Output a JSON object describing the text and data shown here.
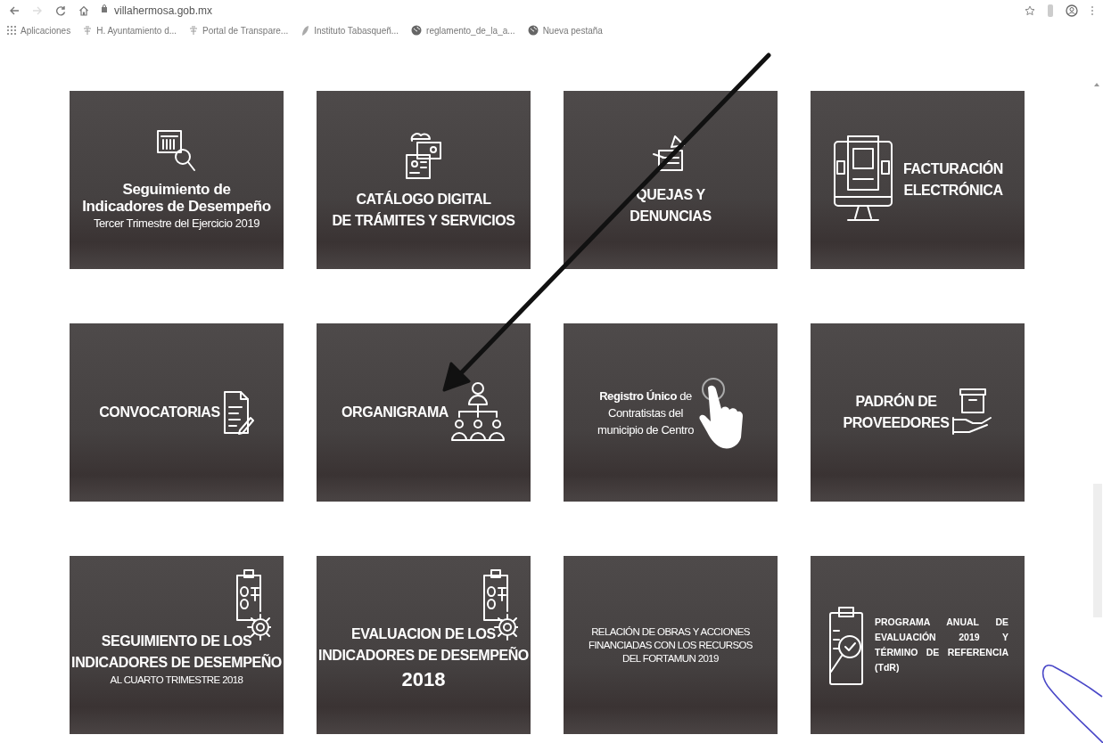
{
  "toolbar": {
    "forward_button": {
      "disabled": true
    },
    "url": "villahermosa.gob.mx"
  },
  "bookmarks": [
    {
      "label": "Aplicaciones",
      "kind": "apps"
    },
    {
      "label": "H. Ayuntamiento d...",
      "kind": "site"
    },
    {
      "label": "Portal de Transpare...",
      "kind": "site"
    },
    {
      "label": "Instituto Tabasqueñ...",
      "kind": "leaf"
    },
    {
      "label": "reglamento_de_la_a...",
      "kind": "globe"
    },
    {
      "label": "Nueva pestaña",
      "kind": "globe"
    }
  ],
  "tiles": [
    {
      "kind": "icon-top",
      "lines": [
        {
          "text": "Seguimiento de",
          "kind": "title"
        },
        {
          "text": "Indicadores de Desempeño",
          "kind": "title"
        },
        {
          "text": "Tercer Trimestre del Ejercicio 2019",
          "kind": "sub"
        }
      ]
    },
    {
      "kind": "icon-top",
      "lines": [
        {
          "text": "CATÁLOGO DIGITAL",
          "kind": "caps"
        },
        {
          "text": "DE TRÁMITES Y SERVICIOS",
          "kind": "caps"
        }
      ]
    },
    {
      "kind": "icon-top",
      "lines": [
        {
          "text": "QUEJAS Y",
          "kind": "caps"
        },
        {
          "text": "DENUNCIAS",
          "kind": "caps"
        }
      ]
    },
    {
      "kind": "icon-left",
      "lines": [
        {
          "text": "FACTURACIÓN",
          "kind": "caps"
        },
        {
          "text": "ELECTRÓNICA",
          "kind": "caps"
        }
      ]
    },
    {
      "kind": "icon-right",
      "lines": [
        {
          "text": "CONVOCATORIAS",
          "kind": "caps"
        }
      ]
    },
    {
      "kind": "icon-right",
      "lines": [
        {
          "text": "ORGANIGRAMA",
          "kind": "caps"
        }
      ]
    },
    {
      "kind": "icon-right",
      "lines": [
        {
          "text": "**Registro Único** de",
          "kind": "sub"
        },
        {
          "text": "Contratistas del",
          "kind": "sub"
        },
        {
          "text": "municipio de Centro",
          "kind": "sub"
        }
      ]
    },
    {
      "kind": "icon-right",
      "lines": [
        {
          "text": "PADRÓN DE",
          "kind": "caps"
        },
        {
          "text": "PROVEEDORES",
          "kind": "caps"
        }
      ]
    },
    {
      "kind": "icon-corner",
      "lines": [
        {
          "text": "SEGUIMIENTO DE LOS",
          "kind": "caps"
        },
        {
          "text": "INDICADORES DE DESEMPEÑO",
          "kind": "caps"
        },
        {
          "text": "AL CUARTO TRIMESTRE 2018",
          "kind": "small"
        }
      ]
    },
    {
      "kind": "icon-corner",
      "lines": [
        {
          "text": "EVALUACION DE LOS",
          "kind": "caps"
        },
        {
          "text": "INDICADORES DE DESEMPEÑO",
          "kind": "caps"
        },
        {
          "text": "2018",
          "kind": "big"
        }
      ]
    },
    {
      "kind": "text-only",
      "lines": [
        {
          "text": "RELACIÓN DE OBRAS Y ACCIONES",
          "kind": "small"
        },
        {
          "text": "FINANCIADAS CON LOS RECURSOS",
          "kind": "small"
        },
        {
          "text": "DEL FORTAMUN 2019",
          "kind": "small"
        }
      ]
    },
    {
      "kind": "icon-left",
      "lines": [
        {
          "text": "PROGRAMA ANUAL DE",
          "kind": "justify"
        },
        {
          "text": "EVALUACIÓN 2019 Y",
          "kind": "justify"
        },
        {
          "text": "TÉRMINO DE REFERENCIA",
          "kind": "justify"
        },
        {
          "text": "(TdR)",
          "kind": "justify-last"
        }
      ]
    }
  ]
}
